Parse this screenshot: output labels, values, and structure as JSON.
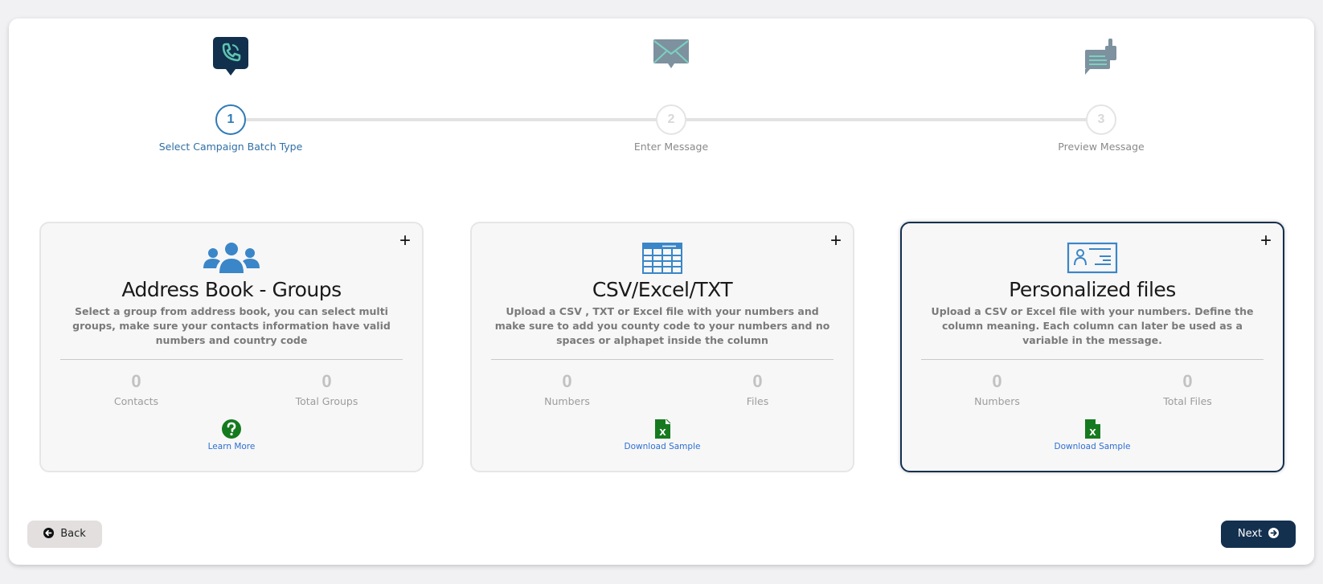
{
  "stepper": {
    "steps": [
      {
        "number": "1",
        "label": "Select Campaign Batch Type",
        "icon": "phone-bubble-icon",
        "state": "active"
      },
      {
        "number": "2",
        "label": "Enter Message",
        "icon": "envelope-icon",
        "state": "inactive"
      },
      {
        "number": "3",
        "label": "Preview Message",
        "icon": "chat-thumbs-up-icon",
        "state": "inactive"
      }
    ]
  },
  "cards": [
    {
      "title": "Address Book - Groups",
      "icon": "users-group-icon",
      "description": "Select a group from address book, you can select multi groups, make sure your contacts information have valid numbers and country code",
      "stats": [
        {
          "value": "0",
          "label": "Contacts"
        },
        {
          "value": "0",
          "label": "Total Groups"
        }
      ],
      "action": {
        "label": "Learn More",
        "icon": "question-circle-icon"
      },
      "selected": false
    },
    {
      "title": "CSV/Excel/TXT",
      "icon": "spreadsheet-table-icon",
      "description": "Upload a CSV , TXT or Excel file with your numbers and make sure to add you county code to your numbers and no spaces or alphapet inside the column",
      "stats": [
        {
          "value": "0",
          "label": "Numbers"
        },
        {
          "value": "0",
          "label": "Files"
        }
      ],
      "action": {
        "label": "Download Sample",
        "icon": "excel-file-icon"
      },
      "selected": false
    },
    {
      "title": "Personalized files",
      "icon": "id-card-icon",
      "description": "Upload a CSV or Excel file with your numbers. Define the column meaning. Each column can later be used as a variable in the message.",
      "stats": [
        {
          "value": "0",
          "label": "Numbers"
        },
        {
          "value": "0",
          "label": "Total Files"
        }
      ],
      "action": {
        "label": "Download Sample",
        "icon": "excel-file-icon"
      },
      "selected": true
    }
  ],
  "buttons": {
    "back": "Back",
    "next": "Next"
  },
  "colors": {
    "primary": "#13304f",
    "accent_blue": "#2f7ab8",
    "icon_blue": "#3a86c8",
    "excel_green": "#157a1f",
    "link_blue": "#2f6fd0",
    "teal": "#5ec3b0"
  },
  "card_plus_symbol": "+"
}
